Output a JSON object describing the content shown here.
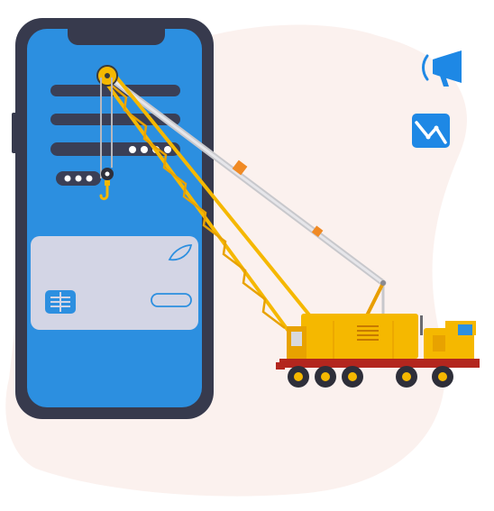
{
  "illustration": {
    "subject": "phone-and-crane",
    "colors": {
      "blob": "#FBF1EE",
      "phone_frame": "#373A4D",
      "phone_screen": "#2C8FE0",
      "phone_bars": "#3A3F56",
      "card": "#D3D5E5",
      "card_accent": "#2C8FE0",
      "crane_yellow": "#F5B800",
      "crane_orange": "#E89E00",
      "crane_red": "#B3261E",
      "wheel": "#2E2F3A",
      "icon_blue": "#1E88E5"
    }
  },
  "side_icons": [
    {
      "name": "megaphone-icon"
    },
    {
      "name": "line-chart-icon"
    }
  ]
}
